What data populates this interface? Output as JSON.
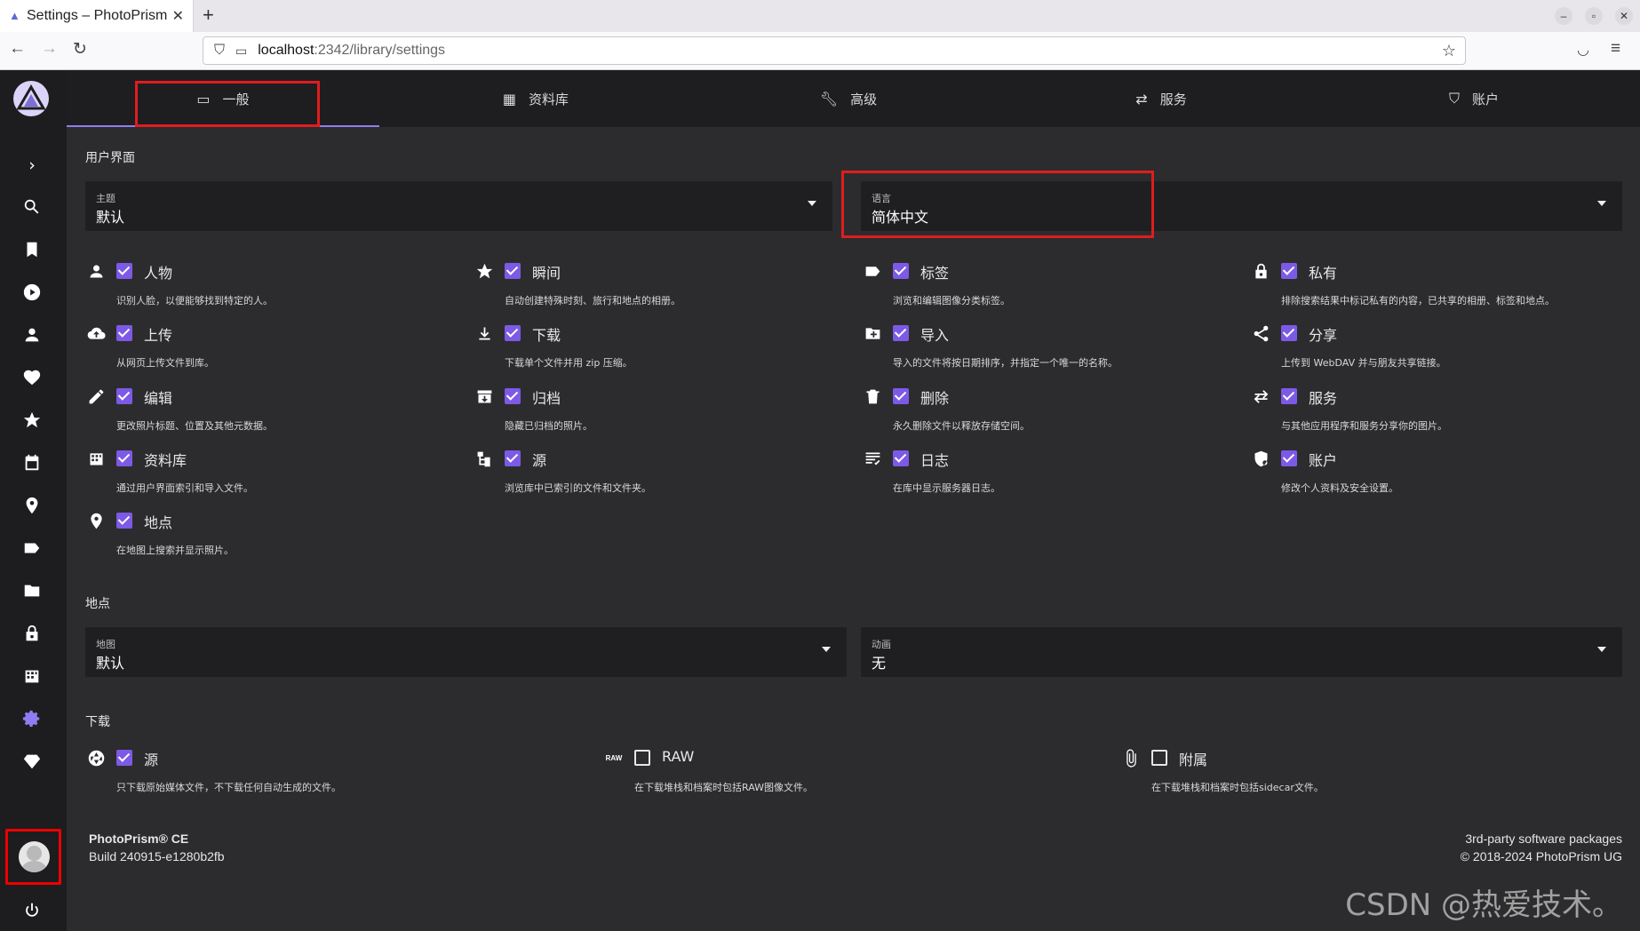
{
  "browser": {
    "tab_title": "Settings – PhotoPrism",
    "url_host": "localhost",
    "url_rest": ":2342/library/settings"
  },
  "tabs": [
    {
      "label": "一般",
      "icon": "monitor-icon"
    },
    {
      "label": "资料库",
      "icon": "library-icon"
    },
    {
      "label": "高级",
      "icon": "wrench-icon"
    },
    {
      "label": "服务",
      "icon": "swap-icon"
    },
    {
      "label": "账户",
      "icon": "shield-account-icon"
    }
  ],
  "ui_section": {
    "title": "用户界面",
    "theme": {
      "label": "主题",
      "value": "默认"
    },
    "language": {
      "label": "语言",
      "value": "简体中文"
    }
  },
  "features": [
    {
      "name": "人物",
      "desc": "识别人脸，以便能够找到特定的人。",
      "checked": true,
      "icon": "person-icon"
    },
    {
      "name": "瞬间",
      "desc": "自动创建特殊时刻、旅行和地点的相册。",
      "checked": true,
      "icon": "star-icon"
    },
    {
      "name": "标签",
      "desc": "浏览和编辑图像分类标签。",
      "checked": true,
      "icon": "label-icon"
    },
    {
      "name": "私有",
      "desc": "排除搜索结果中标记私有的内容，已共享的相册、标签和地点。",
      "checked": true,
      "icon": "lock-icon"
    },
    {
      "name": "上传",
      "desc": "从网页上传文件到库。",
      "checked": true,
      "icon": "cloud-upload-icon"
    },
    {
      "name": "下载",
      "desc": "下载单个文件并用 zip 压缩。",
      "checked": true,
      "icon": "download-icon"
    },
    {
      "name": "导入",
      "desc": "导入的文件将按日期排序，并指定一个唯一的名称。",
      "checked": true,
      "icon": "folder-plus-icon"
    },
    {
      "name": "分享",
      "desc": "上传到 WebDAV 并与朋友共享链接。",
      "checked": true,
      "icon": "share-icon"
    },
    {
      "name": "编辑",
      "desc": "更改照片标题、位置及其他元数据。",
      "checked": true,
      "icon": "pencil-icon"
    },
    {
      "name": "归档",
      "desc": "隐藏已归档的照片。",
      "checked": true,
      "icon": "archive-icon"
    },
    {
      "name": "删除",
      "desc": "永久删除文件以释放存储空间。",
      "checked": true,
      "icon": "trash-icon"
    },
    {
      "name": "服务",
      "desc": "与其他应用程序和服务分享你的图片。",
      "checked": true,
      "icon": "swap-icon"
    },
    {
      "name": "资料库",
      "desc": "通过用户界面索引和导入文件。",
      "checked": true,
      "icon": "library-icon"
    },
    {
      "name": "源",
      "desc": "浏览库中已索引的文件和文件夹。",
      "checked": true,
      "icon": "file-tree-icon"
    },
    {
      "name": "日志",
      "desc": "在库中显示服务器日志。",
      "checked": true,
      "icon": "log-list-icon"
    },
    {
      "name": "账户",
      "desc": "修改个人资料及安全设置。",
      "checked": true,
      "icon": "shield-account-icon"
    },
    {
      "name": "地点",
      "desc": "在地图上搜索并显示照片。",
      "checked": true,
      "icon": "map-marker-icon"
    }
  ],
  "places_section": {
    "title": "地点",
    "map": {
      "label": "地图",
      "value": "默认"
    },
    "animation": {
      "label": "动画",
      "value": "无"
    }
  },
  "download_section": {
    "title": "下载",
    "items": [
      {
        "name": "源",
        "desc": "只下载原始媒体文件，不下载任何自动生成的文件。",
        "checked": true,
        "icon": "aperture-icon"
      },
      {
        "name": "RAW",
        "desc": "在下载堆栈和档案时包括RAW图像文件。",
        "checked": false,
        "icon": "raw-icon",
        "icon_text": "RAW"
      },
      {
        "name": "附属",
        "desc": "在下载堆栈和档案时包括sidecar文件。",
        "checked": false,
        "icon": "paperclip-icon"
      }
    ]
  },
  "footer": {
    "product": "PhotoPrism® CE",
    "build": "Build 240915-e1280b2fb",
    "packages": "3rd-party software packages",
    "copyright": "© 2018-2024 PhotoPrism UG"
  },
  "watermark": "CSDN @热爱技术。",
  "colors": {
    "accent": "#7c5ae6",
    "highlight": "#e01d1d"
  }
}
